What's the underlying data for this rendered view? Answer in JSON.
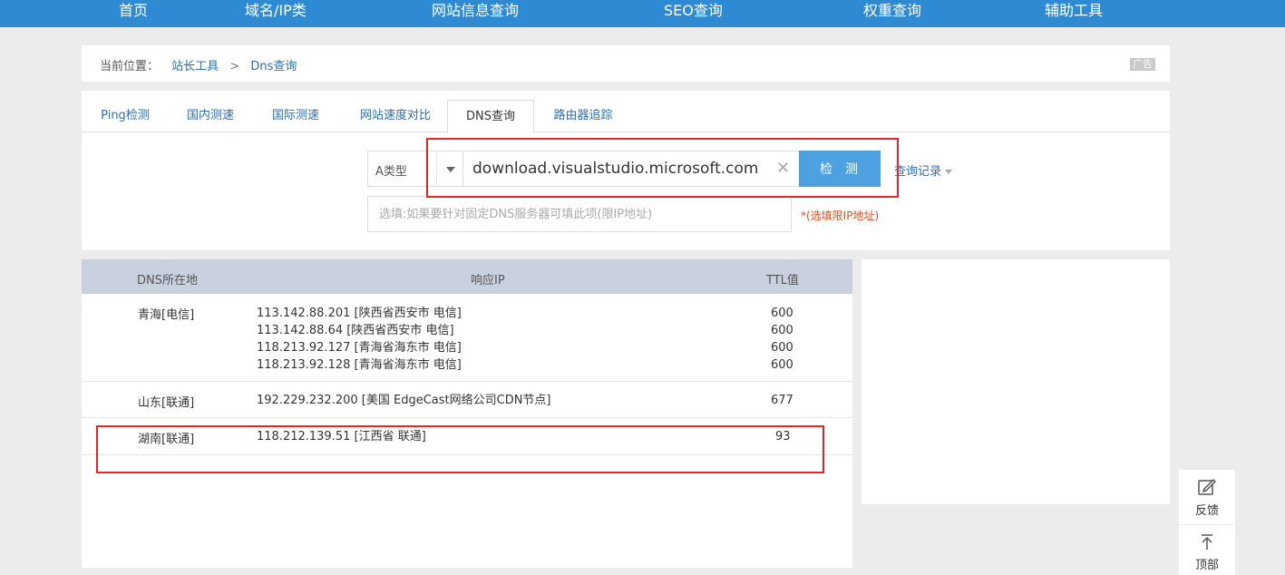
{
  "topnav": {
    "items": [
      "首页",
      "域名/IP类",
      "网站信息查询",
      "SEO查询",
      "权重查询",
      "辅助工具"
    ]
  },
  "breadcrumb": {
    "here": "当前位置：",
    "link1": "站长工具",
    "sep": ">",
    "link2": "Dns查询",
    "ad": "广告"
  },
  "tabs": [
    "Ping检测",
    "国内测速",
    "国际测速",
    "网站速度对比",
    "DNS查询",
    "路由器追踪"
  ],
  "query": {
    "type_value": "A类型",
    "domain_value": "download.visualstudio.microsoft.com",
    "check_label": "检测",
    "history_label": "查询记录",
    "dns_placeholder": "选填:如果要针对固定DNS服务器可填此项(限IP地址)",
    "dns_note": "*(选填限IP地址)"
  },
  "results": {
    "headers": {
      "location": "DNS所在地",
      "ip": "响应IP",
      "ttl": "TTL值"
    },
    "rows": [
      {
        "location": "青海[电信]",
        "ips": [
          "113.142.88.201 [陕西省西安市 电信]",
          "113.142.88.64 [陕西省西安市 电信]",
          "118.213.92.127 [青海省海东市 电信]",
          "118.213.92.128 [青海省海东市 电信]"
        ],
        "ttls": [
          "600",
          "600",
          "600",
          "600"
        ]
      },
      {
        "location": "山东[联通]",
        "ips": [
          "192.229.232.200 [美国 EdgeCast网络公司CDN节点]"
        ],
        "ttls": [
          "677"
        ]
      },
      {
        "location": "湖南[联通]",
        "ips": [
          "118.212.139.51 [江西省 联通]"
        ],
        "ttls": [
          "93"
        ]
      }
    ]
  },
  "float_tools": {
    "feedback": "反馈",
    "top": "顶部"
  },
  "colors": {
    "nav_blue": "#2e8bd3",
    "button_blue": "#4ea1e0",
    "link_blue": "#2c6eae",
    "highlight_red": "#e02828",
    "note_red": "#e24a1d"
  }
}
